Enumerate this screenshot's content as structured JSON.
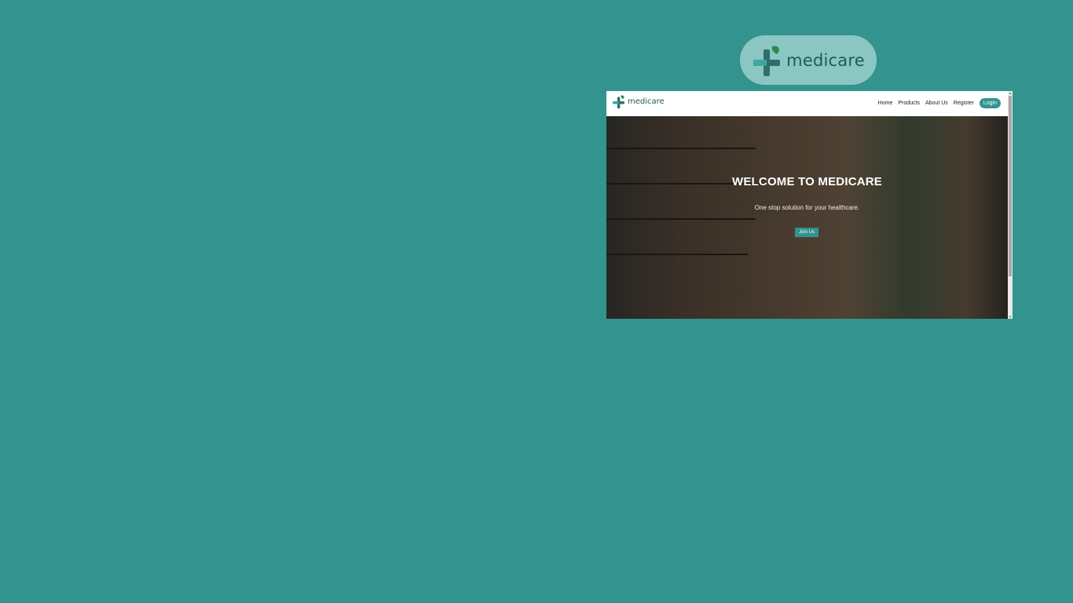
{
  "outer_logo": {
    "text": "medicare",
    "icon": "medical-cross-leaf-icon"
  },
  "site": {
    "brand": {
      "text": "medicare",
      "icon": "medical-cross-leaf-icon"
    },
    "nav": {
      "items": [
        {
          "label": "Home"
        },
        {
          "label": "Products"
        },
        {
          "label": "About Us"
        },
        {
          "label": "Register"
        }
      ],
      "login_label": "Login"
    },
    "hero": {
      "title": "WELCOME TO MEDICARE",
      "subtitle": "One stop solution for your healthcare.",
      "button_label": "Join Us"
    }
  },
  "colors": {
    "background": "#33938f",
    "accent": "#33938f",
    "logo_pill": "#8cc6c2",
    "brand_text": "#1f5a57"
  }
}
